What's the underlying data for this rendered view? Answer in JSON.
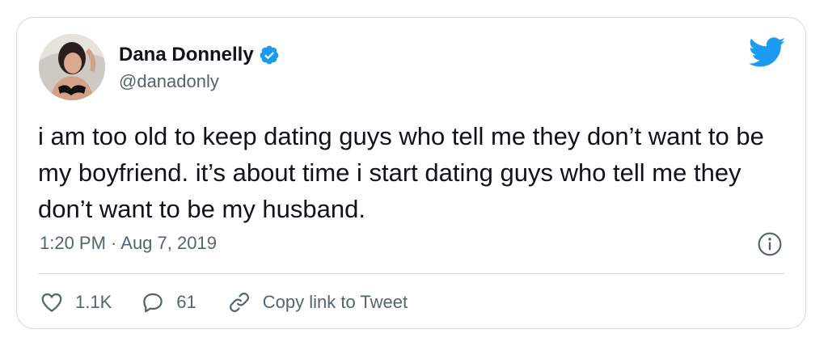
{
  "author": {
    "name": "Dana Donnelly",
    "handle": "@danadonly",
    "verified": true
  },
  "tweet": {
    "text": "i am too old to keep dating guys who tell me they don’t want to be my boyfriend. it’s about time i start dating guys who tell me they don’t want to be my husband.",
    "timestamp": "1:20 PM · Aug 7, 2019"
  },
  "actions": {
    "likes": "1.1K",
    "replies": "61",
    "copy_link_label": "Copy link to Tweet"
  },
  "icons": {
    "brand": "twitter-bird-icon",
    "verified": "verified-badge-icon",
    "info": "info-icon",
    "like": "heart-icon",
    "reply": "reply-bubble-icon",
    "link": "link-icon"
  },
  "colors": {
    "accent": "#1d9bf0",
    "text": "#0f1419",
    "muted": "#536471",
    "border": "#cfd9de"
  }
}
